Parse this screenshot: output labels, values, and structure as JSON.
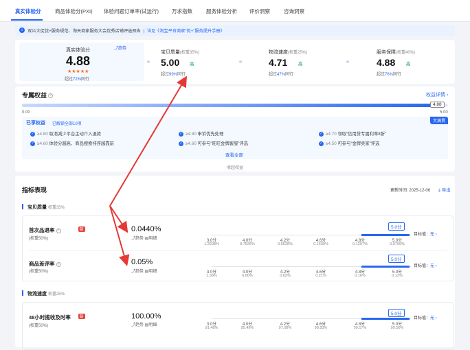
{
  "tabs": [
    "真实体验分",
    "商品体验分(PXI)",
    "体验问题订单率(试运行)",
    "万求指数",
    "服务体验分析",
    "评价洞察",
    "咨询洞察"
  ],
  "notice": {
    "text": "双11大促优+服务规范、淘天商家服务大会优秀店铺评选预告",
    "link": "详见《淘宝平台商家“优+”服务提升手册》",
    "sep": "|"
  },
  "score": {
    "title": "真实体验分",
    "value": "4.88",
    "stars": "★★★★★",
    "beat_prefix": "超过",
    "beat_pct": "72%",
    "beat_suffix": "同行",
    "trend": "趋势",
    "dims": [
      {
        "name": "宝贝质量",
        "weight": "(权重35%)",
        "value": "5.00",
        "level": "高",
        "beat_prefix": "超过",
        "beat_pct": "99%",
        "beat_suffix": "同行"
      },
      {
        "name": "物流速度",
        "weight": "(权重25%)",
        "value": "4.71",
        "level": "高",
        "beat_prefix": "超过",
        "beat_pct": "47%",
        "beat_suffix": "同行"
      },
      {
        "name": "服务保障",
        "weight": "(权重40%)",
        "value": "4.88",
        "level": "高",
        "beat_prefix": "超过",
        "beat_pct": "76%",
        "beat_suffix": "同行"
      }
    ]
  },
  "rights": {
    "title": "专属权益",
    "detail_link": "权益详情 ›",
    "bar_min": "0.00",
    "bar_max": "5.00",
    "bar_current": "4.88",
    "bar_fraction": 0.976,
    "badge": "大满贯",
    "enjoyed_title": "已享权益",
    "enjoyed_sub": "已解锁全部10项",
    "items": [
      {
        "req": "≥4.80",
        "text": "取消减少平台主动介入退款"
      },
      {
        "req": "≥4.80",
        "text": "申诉优先处理"
      },
      {
        "req": "≥4.70",
        "text": "领取“信用贷专属利率8折”"
      },
      {
        "req": "≥4.60",
        "text": "体验分越高、商品搜索排序越靠前"
      },
      {
        "req": "≥4.60",
        "text": "可参与“旺旺金牌客服”评选"
      },
      {
        "req": "≥4.50",
        "text": "可参与“金牌卖家”评选"
      }
    ],
    "view_all": "查看全部",
    "collapse": "收起权益"
  },
  "indicators": {
    "title": "指标表现",
    "updated_label": "更新时间:",
    "updated": "2025-12-06",
    "export": "导出",
    "groups": [
      {
        "name": "宝贝质量",
        "weight": "权重35%"
      },
      {
        "name": "物流速度",
        "weight": "权重25%"
      }
    ],
    "metrics": [
      {
        "name": "首次品退率",
        "weight": "(权重50%)",
        "new": "新",
        "value": "0.0440%",
        "trend": "趋势",
        "detail": "明细",
        "score_tag": "5.0分",
        "target_label": "目标值：",
        "target": "无",
        "ticks": [
          {
            "score": "3.0分",
            "val": "1.2698%"
          },
          {
            "score": "4.0分",
            "val": "0.7526%"
          },
          {
            "score": "4.2分",
            "val": "0.5628%"
          },
          {
            "score": "4.6分",
            "val": "0.1639%"
          },
          {
            "score": "4.8分",
            "val": "0.1207%"
          },
          {
            "score": "5.0分",
            "val": "0.0799%"
          }
        ]
      },
      {
        "name": "商品差评率",
        "weight": "(权重50%)",
        "new": "",
        "value": "0.05%",
        "trend": "趋势",
        "detail": "明细",
        "score_tag": "5.0分",
        "target_label": "目标值：",
        "target": "无",
        "ticks": [
          {
            "score": "3.0分",
            "val": "1.38%"
          },
          {
            "score": "4.0分",
            "val": "0.80%"
          },
          {
            "score": "4.2分",
            "val": "0.62%"
          },
          {
            "score": "4.6分",
            "val": "0.21%"
          },
          {
            "score": "4.8分",
            "val": "0.16%"
          },
          {
            "score": "5.0分",
            "val": "0.12%"
          }
        ]
      },
      {
        "name": "48小时揽收及时率",
        "weight": "(权重50%)",
        "new": "新",
        "value": "100.00%",
        "trend": "趋势",
        "detail": "明细",
        "score_tag": "5.0分",
        "target_label": "目标值：",
        "target": "无",
        "ticks": [
          {
            "score": "3.0分",
            "val": "91.48%"
          },
          {
            "score": "4.0分",
            "val": "95.49%"
          },
          {
            "score": "4.2分",
            "val": "97.08%"
          },
          {
            "score": "4.6分",
            "val": "98.83%"
          },
          {
            "score": "4.8分",
            "val": "99.17%"
          },
          {
            "score": "5.0分",
            "val": "99.50%"
          }
        ]
      }
    ]
  },
  "colors": {
    "accent": "#2867f0",
    "good": "#0f9d58",
    "warn": "#e8463a",
    "arrow": "#e53935",
    "star": "#ff6a00"
  }
}
